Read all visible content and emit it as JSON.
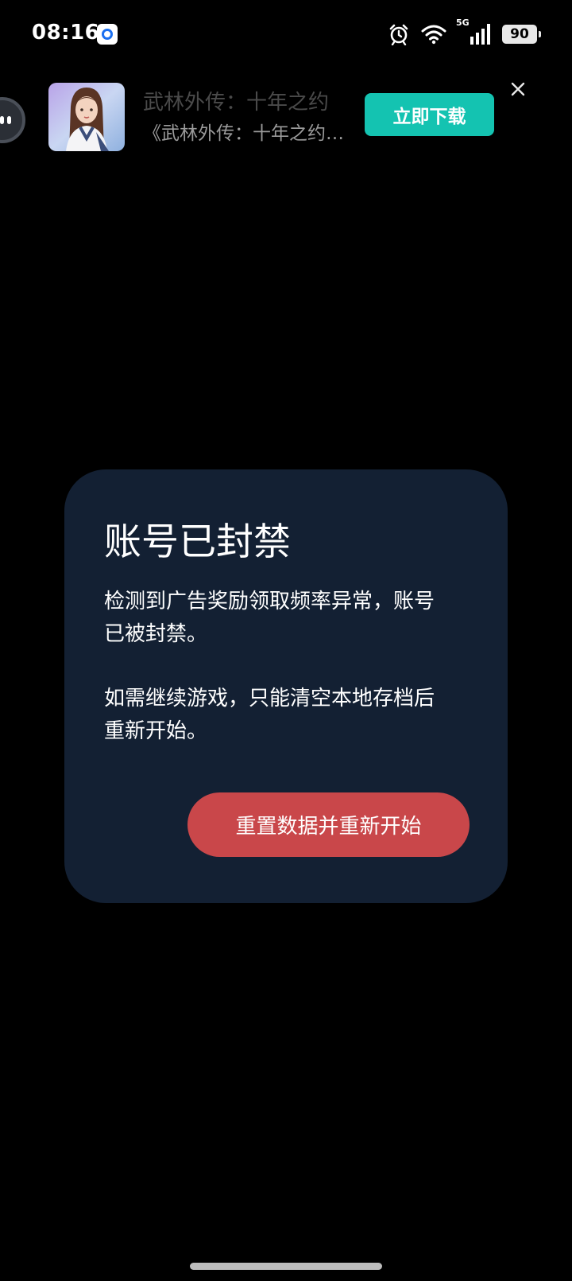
{
  "status_bar": {
    "time": "08:16",
    "network": "5G",
    "battery": "90"
  },
  "ad": {
    "title": "武林外传：十年之约",
    "subtitle": "《武林外传：十年之约…",
    "download_label": "立即下载"
  },
  "dialog": {
    "title": "账号已封禁",
    "paragraph1": "检测到广告奖励领取频率异常，账号已被封禁。",
    "paragraph2": "如需继续游戏，只能清空本地存档后重新开始。",
    "button_label": "重置数据并重新开始"
  },
  "colors": {
    "background": "#000000",
    "dialog_bg": "#132033",
    "button_bg": "#c9474a",
    "ad_button_bg": "#14c3b1"
  }
}
